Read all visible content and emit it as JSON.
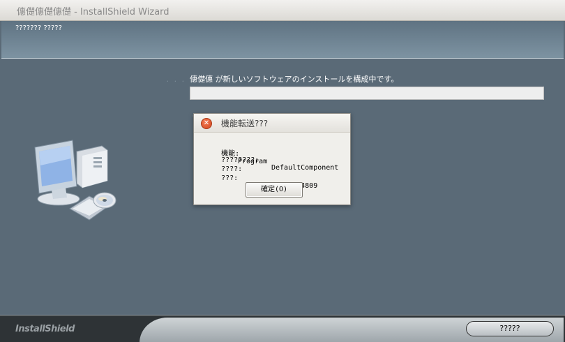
{
  "window": {
    "title": "僡儊僡儊僡儊 - InstallShield Wizard"
  },
  "header": {
    "subtitle": "??????? ?????"
  },
  "main": {
    "status_dots": ". . .",
    "status_text": "僡儊僡 が新しいソフトウェアのインストールを構成中です。",
    "progress_label": "?",
    "progress_fraction": 0.0
  },
  "dialog": {
    "title": "機能転送???",
    "rows": [
      {
        "label": "機能:",
        "value": "Program"
      },
      {
        "label": "????????:",
        "value": "DefaultComponent"
      },
      {
        "label": "????:",
        "value": ""
      },
      {
        "label": "???:",
        "value": "-2147024809"
      }
    ],
    "ok_label": "確定(O)",
    "close_glyph": "✕"
  },
  "footer": {
    "logo": "InstallShield",
    "cancel_label": "?????"
  },
  "colors": {
    "panel": "#5a6a77",
    "header": "#6f8595",
    "footer_dark": "#2e3336",
    "close_red": "#e05a33"
  }
}
